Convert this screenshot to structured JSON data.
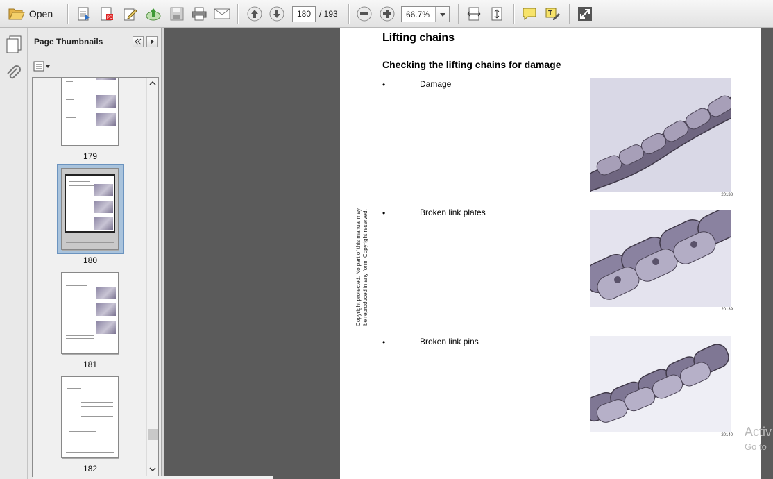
{
  "toolbar": {
    "open_label": "Open",
    "page_current": "180",
    "page_total": "/ 193",
    "zoom": "66.7%",
    "icons": [
      "folder-open-icon",
      "create-pdf-icon",
      "convert-pdf-icon",
      "edit-icon",
      "upload-icon",
      "save-icon",
      "print-icon",
      "email-icon",
      "previous-page-icon",
      "next-page-icon",
      "zoom-out-icon",
      "zoom-in-icon",
      "fit-width-icon",
      "fit-page-icon",
      "comment-icon",
      "highlight-icon",
      "fullscreen-icon"
    ]
  },
  "nav_panel": {
    "title": "Page Thumbnails",
    "thumbnails": [
      {
        "label": "179"
      },
      {
        "label": "180",
        "selected": true
      },
      {
        "label": "181"
      },
      {
        "label": "182"
      }
    ]
  },
  "document": {
    "title": "Lifting chains",
    "subtitle": "Checking the lifting chains for damage",
    "items": [
      {
        "bullet": "•",
        "text": "Damage",
        "photo_id": "20138"
      },
      {
        "bullet": "•",
        "text": "Broken link plates",
        "photo_id": "20139"
      },
      {
        "bullet": "•",
        "text": "Broken link pins",
        "photo_id": "20140"
      }
    ],
    "copyright": "Copyright protected. No part of this manual may be reproduced in any form. Copyright reserved."
  },
  "overlay": {
    "watermark_line1": "Activ",
    "watermark_line2": "Go to"
  }
}
